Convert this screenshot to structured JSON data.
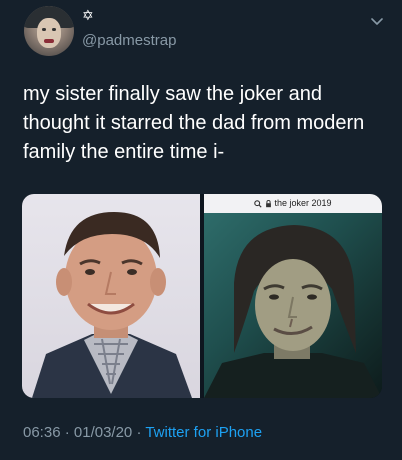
{
  "header": {
    "display_name": "✡",
    "handle": "@padmestrap"
  },
  "tweet": {
    "text": "my sister finally saw the joker and thought it starred the dad from modern family the entire time i-"
  },
  "media": {
    "left_photo": {
      "subject": "smiling man in suit and checkered shirt"
    },
    "right_photo": {
      "search_query": "the joker 2019",
      "icons": [
        "search-icon",
        "lock-icon"
      ]
    }
  },
  "meta": {
    "time": "06:36",
    "separator1": " · ",
    "date": "01/03/20",
    "separator2": " · ",
    "source": "Twitter for iPhone"
  },
  "colors": {
    "background": "#15202b",
    "secondary_text": "#8899a6",
    "link": "#1da1f2"
  }
}
